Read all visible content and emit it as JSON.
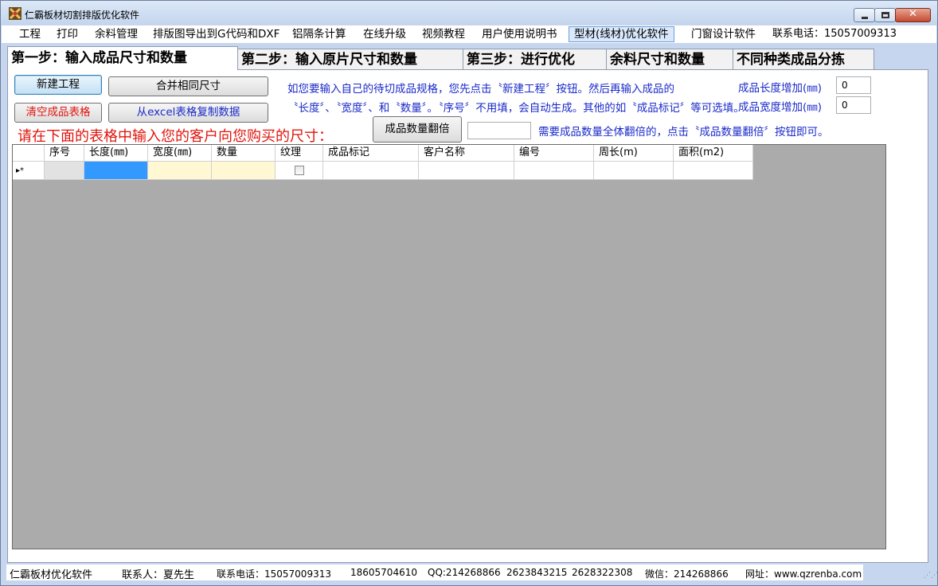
{
  "window": {
    "title": "仁霸板材切割排版优化软件"
  },
  "menu": [
    "工程",
    "打印",
    "余料管理",
    "排版图导出到G代码和DXF",
    "铝隔条计算",
    "在线升级",
    "视频教程",
    "用户使用说明书",
    "型材(线材)优化软件",
    "门窗设计软件",
    "联系电话：15057009313"
  ],
  "tabs": [
    "第一步：输入成品尺寸和数量",
    "第二步：输入原片尺寸和数量",
    "第三步：进行优化",
    "余料尺寸和数量",
    "不同种类成品分拣"
  ],
  "buttons": {
    "new_project": "新建工程",
    "merge_sizes": "合并相同尺寸",
    "clear_table": "清空成品表格",
    "copy_excel": "从excel表格复制数据",
    "double_qty": "成品数量翻倍"
  },
  "help": {
    "line1": "如您要输入自己的待切成品规格，您先点击〝新建工程〞按钮。然后再输入成品的",
    "line2": "〝长度〞、〝宽度〞、和〝数量〞。〝序号〞不用填，会自动生成。其他的如〝成品标记〞等可选填。",
    "instruction": "请在下面的表格中输入您的客户向您购买的尺寸：",
    "double_hint": "需要成品数量全体翻倍的，点击〝成品数量翻倍〞按钮即可。"
  },
  "increments": {
    "length_label": "成品长度增加(㎜)",
    "length_value": "0",
    "width_label": "成品宽度增加(㎜)",
    "width_value": "0"
  },
  "double_qty_value": "",
  "grid": {
    "columns": [
      "",
      "序号",
      "长度(㎜)",
      "宽度(㎜)",
      "数量",
      "纹理",
      "成品标记",
      "客户名称",
      "编号",
      "周长(m)",
      "面积(m2)"
    ],
    "new_row_marker": "▸*"
  },
  "status": {
    "app": "仁霸板材优化软件",
    "contact": "联系人：夏先生",
    "phone": "联系电话：15057009313",
    "phone2": "18605704610",
    "qq": "QQ:214268866",
    "qq2": "2623843215",
    "qq3": "2628322308",
    "wechat": "微信：214268866",
    "website": "网址：www.qzrenba.com"
  }
}
